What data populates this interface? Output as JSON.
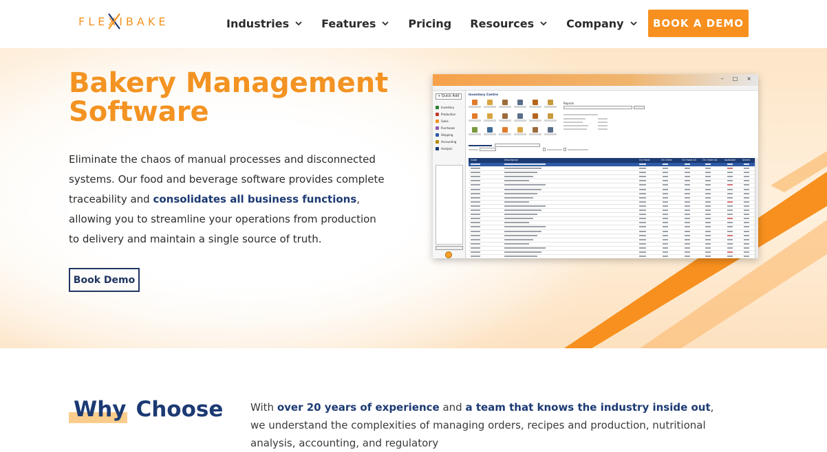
{
  "brand": {
    "logo_text": "FLEXIBAKE",
    "accent": "#f7901e",
    "navy": "#1c3a73"
  },
  "nav": {
    "items": [
      {
        "label": "Industries",
        "dropdown": true
      },
      {
        "label": "Features",
        "dropdown": true
      },
      {
        "label": "Pricing",
        "dropdown": false
      },
      {
        "label": "Resources",
        "dropdown": true
      },
      {
        "label": "Company",
        "dropdown": true
      }
    ],
    "cta_label": "BOOK A DEMO"
  },
  "hero": {
    "title_line1": "Bakery Management",
    "title_line2": "Software",
    "desc_part1": "Eliminate the chaos of manual processes and disconnected systems. Our food and beverage software provides complete traceability and ",
    "desc_bold": "consolidates all business functions",
    "desc_part2": ", allowing you to streamline your operations from production to delivery and maintain a single source of truth.",
    "button_label": "Book Demo"
  },
  "app_window": {
    "window_controls": [
      "–",
      "□",
      "×"
    ],
    "quick_add_label": "+ Quick Add",
    "sidebar_items": [
      "Inventory",
      "Production",
      "Sales",
      "Purchases",
      "Shipping",
      "Accounting",
      "Analysis"
    ],
    "sidebar_item_colors": [
      "#2f7d32",
      "#c0392b",
      "#f39322",
      "#8e5aa8",
      "#2d5aa6",
      "#b58a00",
      "#1c3a73"
    ],
    "section_title": "Inventory Centre",
    "reports_label": "Reports",
    "tile_colors": [
      "#e07b2c",
      "#d9a441",
      "#9b6b3a",
      "#5a6e8a",
      "#b5651d",
      "#c79a3c",
      "#e07b2c",
      "#d9a441",
      "#9b6b3a",
      "#5a6e8a",
      "#b5651d",
      "#c79a3c",
      "#7a9a3c",
      "#3c6b9a",
      "#e07b2c",
      "#d9a441",
      "#9b6b3a",
      "#5a6e8a"
    ],
    "row_count": 24,
    "selected_row": 0
  },
  "why": {
    "title_word1": "Why",
    "title_word2": "Choose",
    "text_part1": "With ",
    "text_bold1": "over 20 years of experience",
    "text_part2": " and ",
    "text_bold2": "a team that knows the industry inside out",
    "text_part3": ", we understand the complexities of managing orders, recipes and production, nutritional analysis, accounting, and regulatory"
  }
}
